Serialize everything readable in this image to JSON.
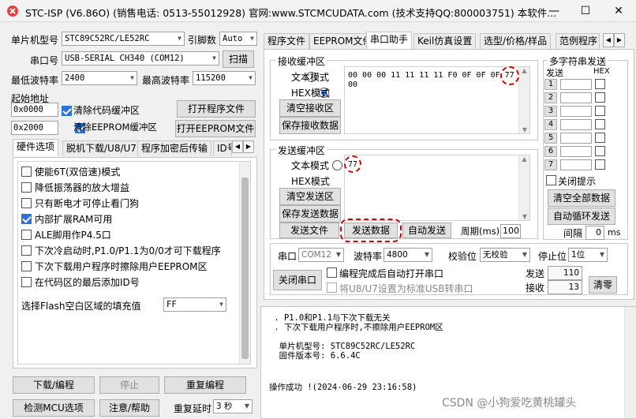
{
  "window": {
    "title": "STC-ISP (V6.86O) (销售电话: 0513-55012928) 官网:www.STCMCUDATA.com  (技术支持QQ:800003751) 本软件...",
    "minimize": "—",
    "maximize": "☐",
    "close": "✕"
  },
  "left": {
    "mcu_label": "单片机型号",
    "mcu_value": "STC89C52RC/LE52RC",
    "pin_label": "引脚数",
    "pin_value": "Auto",
    "port_label": "串口号",
    "port_value": "USB-SERIAL CH340 (COM12)",
    "scan_button": "扫描",
    "min_baud_label": "最低波特率",
    "min_baud_value": "2400",
    "max_baud_label": "最高波特率",
    "max_baud_value": "115200",
    "start_addr_label": "起始地址",
    "addr1": "0x0000",
    "clear_code_label": "清除代码缓冲区",
    "open_prog_button": "打开程序文件",
    "addr2": "0x2000",
    "clear_eeprom_label": "清除EEPROM缓冲区",
    "open_eeprom_button": "打开EEPROM文件",
    "tabs": [
      "硬件选项",
      "脱机下载/U8/U7",
      "程序加密后传输",
      "ID号"
    ],
    "options": [
      {
        "label": "使能6T(双倍速)模式",
        "checked": false
      },
      {
        "label": "降低振荡器的放大增益",
        "checked": false
      },
      {
        "label": "只有断电才可停止看门狗",
        "checked": false
      },
      {
        "label": "内部扩展RAM可用",
        "checked": true
      },
      {
        "label": "ALE脚用作P4.5口",
        "checked": false
      },
      {
        "label": "下次冷启动时,P1.0/P1.1为0/0才可下载程序",
        "checked": false
      },
      {
        "label": "下次下载用户程序时擦除用户EEPROM区",
        "checked": false
      },
      {
        "label": "在代码区的最后添加ID号",
        "checked": false
      }
    ],
    "flash_fill_label": "选择Flash空白区域的填充值",
    "flash_fill_value": "FF",
    "download_button": "下载/编程",
    "stop_button": "停止",
    "reprogram_button": "重复编程",
    "detect_button": "检测MCU选项",
    "help_button": "注意/帮助",
    "repeat_delay_label": "重复延时",
    "repeat_delay_value": "3 秒"
  },
  "right": {
    "tabs": [
      "程序文件",
      "EEPROM文件",
      "串口助手",
      "Keil仿真设置",
      "选型/价格/样品",
      "范例程序"
    ],
    "recv": {
      "group_label": "接收缓冲区",
      "text_mode": "文本模式",
      "hex_mode": "HEX模式",
      "clear_button": "清空接收区",
      "save_button": "保存接收数据",
      "content": "00 00 00 11 11 11 11 F0 0F 0F 0F 77\n00"
    },
    "send": {
      "group_label": "发送缓冲区",
      "text_mode": "文本模式",
      "hex_mode": "HEX模式",
      "clear_button": "清空发送区",
      "save_button": "保存发送数据",
      "content": "77",
      "send_file_button": "发送文件",
      "send_data_button": "发送数据",
      "auto_send_label": "自动发送",
      "period_label": "周期(ms)",
      "period_value": "100"
    },
    "multi": {
      "group_label": "多字符串发送",
      "send_header": "发送",
      "hex_header": "HEX",
      "rows": [
        "1",
        "2",
        "3",
        "4",
        "5",
        "6",
        "7"
      ],
      "close_tip_label": "关闭提示",
      "clear_all_button": "清空全部数据",
      "auto_loop_button": "自动循环发送",
      "interval_label": "间隔",
      "interval_value": "0",
      "interval_unit": "ms"
    },
    "serial": {
      "port_label": "串口",
      "port_value": "COM12",
      "baud_label": "波特率",
      "baud_value": "4800",
      "parity_label": "校验位",
      "parity_value": "无校验",
      "stop_label": "停止位",
      "stop_value": "1位",
      "close_button": "关闭串口",
      "auto_open_label": "编程完成后自动打开串口",
      "u8_label": "将U8/U7设置为标准USB转串口",
      "send_count_label": "发送",
      "send_count": "110",
      "recv_count_label": "接收",
      "recv_count": "13",
      "clear_button": "清零"
    },
    "log": {
      "lines": [
        " . P1.0和P1.1与下次下载无关",
        " . 下次下载用户程序时,不擦除用户EEPROM区",
        "",
        "  单片机型号: STC89C52RC/LE52RC",
        "  固件版本号: 6.6.4C",
        "",
        "",
        "操作成功 !(2024-06-29 23:16:58)"
      ]
    }
  },
  "watermark": "CSDN @小狗爱吃黄桃罐头"
}
